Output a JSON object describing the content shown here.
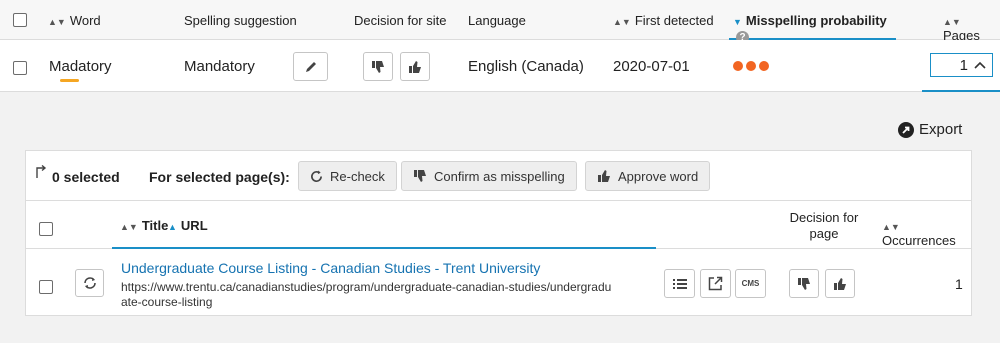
{
  "header": {
    "word": "Word",
    "spelling_suggestion": "Spelling suggestion",
    "decision_for_site": "Decision for site",
    "language": "Language",
    "first_detected": "First detected",
    "misspelling_probability": "Misspelling probability",
    "pages": "Pages"
  },
  "row": {
    "word": "Madatory",
    "suggestion": "Mandatory",
    "language": "English (Canada)",
    "first_detected": "2020-07-01",
    "probability_dots": 3,
    "pages": "1"
  },
  "export_label": "Export",
  "selection": {
    "count_label": "0 selected",
    "for_selected": "For selected page(s):",
    "recheck": "Re-check",
    "confirm": "Confirm as misspelling",
    "approve": "Approve word"
  },
  "sub_header": {
    "title": "Title",
    "url": "URL",
    "decision_line1": "Decision for",
    "decision_line2": "page",
    "occurrences": "Occurrences"
  },
  "sub_row": {
    "title": "Undergraduate Course Listing - Canadian Studies - Trent University",
    "url_line1": "https://www.trentu.ca/canadianstudies/program/undergraduate-canadian-studies/undergradu",
    "url_line2": "ate-course-listing",
    "cms": "CMS",
    "occurrences": "1"
  },
  "colors": {
    "accent": "#1a8fc7",
    "link": "#1673b1",
    "underline": "#f5a623",
    "dots": "#f26522"
  }
}
